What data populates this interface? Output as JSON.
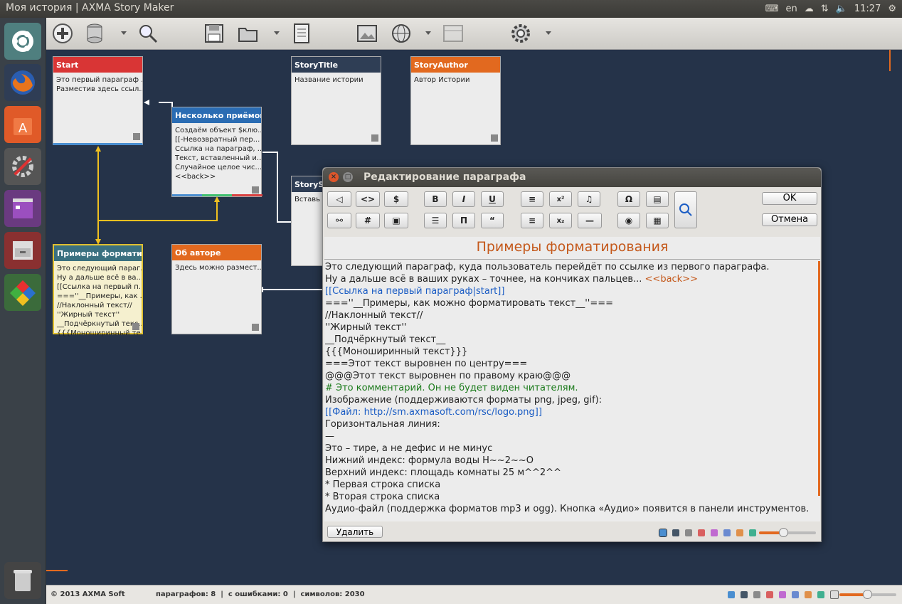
{
  "window_title": "Моя история | AXMA Story Maker",
  "tray": {
    "lang": "en",
    "time": "11:27"
  },
  "cards": {
    "start": {
      "title": "Start",
      "body": "Это первый параграф ...\nРазместив здесь ссыл..."
    },
    "story_title": {
      "title": "StoryTitle",
      "body": "Название истории"
    },
    "story_author": {
      "title": "StoryAuthor",
      "body": "Автор Истории"
    },
    "tricks": {
      "title": "Несколько приёмов",
      "body": "Создаём объект $клю...\n[[-Невозвратный пер...\nСсылка на параграф, ...\nТекст, вставленный и...\nСлучайное целое чис...\n<<back>>"
    },
    "story_sub": {
      "title": "StorySu",
      "body": "Вставь"
    },
    "formatting": {
      "title": "Примеры форматир...",
      "body": "Это следующий параг...\nНу а дальше всё в ва...\n[[Ссылка на первый п...\n===''__Примеры, как ...\n//Наклонный текст//\n''Жирный текст''\n__Подчёркнутый текс...\n{{{Моноширинный те..."
    },
    "about": {
      "title": "Об авторе",
      "body": "Здесь можно размест..."
    }
  },
  "dialog": {
    "title": "Редактирование параграфа",
    "ok": "OK",
    "cancel": "Отмена",
    "delete": "Удалить",
    "heading": "Примеры форматирования",
    "lines": [
      {
        "text": "Это следующий параграф, куда пользователь перейдёт по ссылке из первого параграфа.",
        "cls": ""
      },
      {
        "text": "Ну а дальше всё в ваших руках – точнее, на кончиках пальцев... ",
        "cls": "",
        "tail": "<<back>>",
        "tail_cls": "orange"
      },
      {
        "text": "[[Ссылка на первый параграф|start]]",
        "cls": "blue"
      },
      {
        "text": "===''__Примеры, как можно форматировать текст__''===",
        "cls": ""
      },
      {
        "text": "//Наклонный текст//",
        "cls": ""
      },
      {
        "text": "''Жирный текст''",
        "cls": ""
      },
      {
        "text": "__Подчёркнутый текст__",
        "cls": ""
      },
      {
        "text": "{{{Моноширинный текст}}}",
        "cls": ""
      },
      {
        "text": "===Этот текст выровнен по центру===",
        "cls": ""
      },
      {
        "text": "@@@Этот текст выровнен по правому краю@@@",
        "cls": ""
      },
      {
        "text": "# Это комментарий. Он не будет виден читателям.",
        "cls": "green"
      },
      {
        "text": "Изображение (поддерживаются форматы png, jpeg, gif):",
        "cls": ""
      },
      {
        "text": "[[Файл: http://sm.axmasoft.com/rsc/logo.png]]",
        "cls": "blue"
      },
      {
        "text": "Горизонтальная линия:",
        "cls": ""
      },
      {
        "text": "—",
        "cls": ""
      },
      {
        "text": "Это – тире, а не дефис и не минус",
        "cls": ""
      },
      {
        "text": "Нижний индекс: формула воды H~~2~~O",
        "cls": ""
      },
      {
        "text": "Верхний индекс: площадь комнаты 25 м^^2^^",
        "cls": ""
      },
      {
        "text": "* Первая строка списка",
        "cls": ""
      },
      {
        "text": "* Вторая строка списка",
        "cls": ""
      },
      {
        "text": "Аудио-файл (поддержка форматов mp3 и ogg). Кнопка «Аудио» появится в панели инструментов.",
        "cls": ""
      }
    ],
    "format_buttons_row1": [
      "◁",
      "<>",
      "$",
      "B",
      "I",
      "U",
      "≡",
      "x²",
      "♫",
      "Ω",
      "▤"
    ],
    "format_buttons_row2": [
      "⚯",
      "#",
      "▣",
      "☰",
      "Π",
      "“",
      "≡",
      "x₂",
      "—",
      "◉",
      "▦"
    ]
  },
  "status": {
    "copyright": "© 2013 AXMA Soft",
    "stats": "параграфов: 8  |  с ошибками: 0  |  символов: 2030"
  },
  "colors": {
    "start": "#d93535",
    "story_title": "#2f3e55",
    "story_author": "#e2691f",
    "tricks": "#2a6cb3",
    "formatting": "#3a7080",
    "about": "#e2691f",
    "canvas": "#253349"
  }
}
